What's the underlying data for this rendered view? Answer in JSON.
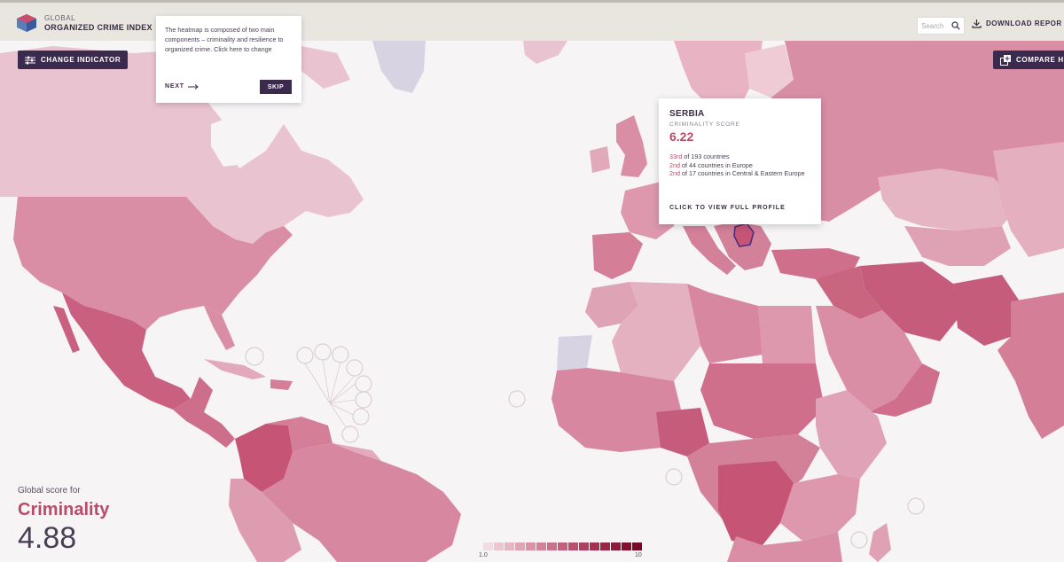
{
  "header": {
    "logo_line1": "GLOBAL",
    "logo_line2": "ORGANIZED CRIME INDEX",
    "search_placeholder": "Search",
    "download_label": "DOWNLOAD REPOR"
  },
  "toolbar": {
    "change_indicator_label": "CHANGE INDICATOR",
    "compare_label": "COMPARE H"
  },
  "onboarding_tip": {
    "text": "The heatmap is composed of two main components – criminality and resilience to organized crime. Click here to change",
    "next_label": "NEXT",
    "skip_label": "SKIP"
  },
  "country_popup": {
    "country": "SERBIA",
    "score_label": "CRIMINALITY SCORE",
    "score": "6.22",
    "ranks": [
      {
        "sup": "33rd",
        "text": " of 193 countries"
      },
      {
        "sup": "2nd",
        "text": " of 44 countries in Europe"
      },
      {
        "sup": "2nd",
        "text": " of 17 countries in Central & Eastern Europe"
      }
    ],
    "link_label": "CLICK TO VIEW FULL PROFILE"
  },
  "global_score": {
    "label": "Global score for",
    "indicator": "Criminality",
    "value": "4.88"
  },
  "legend": {
    "min": "1.0",
    "max": "10",
    "colors": [
      "#f2dbe2",
      "#ecc7d2",
      "#e6b6c3",
      "#e0a4b5",
      "#d993a7",
      "#d28299",
      "#ca718b",
      "#c1607d",
      "#b84f6f",
      "#ae3f61",
      "#a33254",
      "#982647",
      "#8d1b3b",
      "#82112f",
      "#780828"
    ]
  },
  "icons": {
    "change_indicator": "sliders-icon",
    "search": "search-icon",
    "download": "download-icon",
    "compare": "compare-icon",
    "next": "arrow-right-icon"
  },
  "colors": {
    "brand_dark": "#3a2a4d",
    "accent": "#b94a6a"
  }
}
